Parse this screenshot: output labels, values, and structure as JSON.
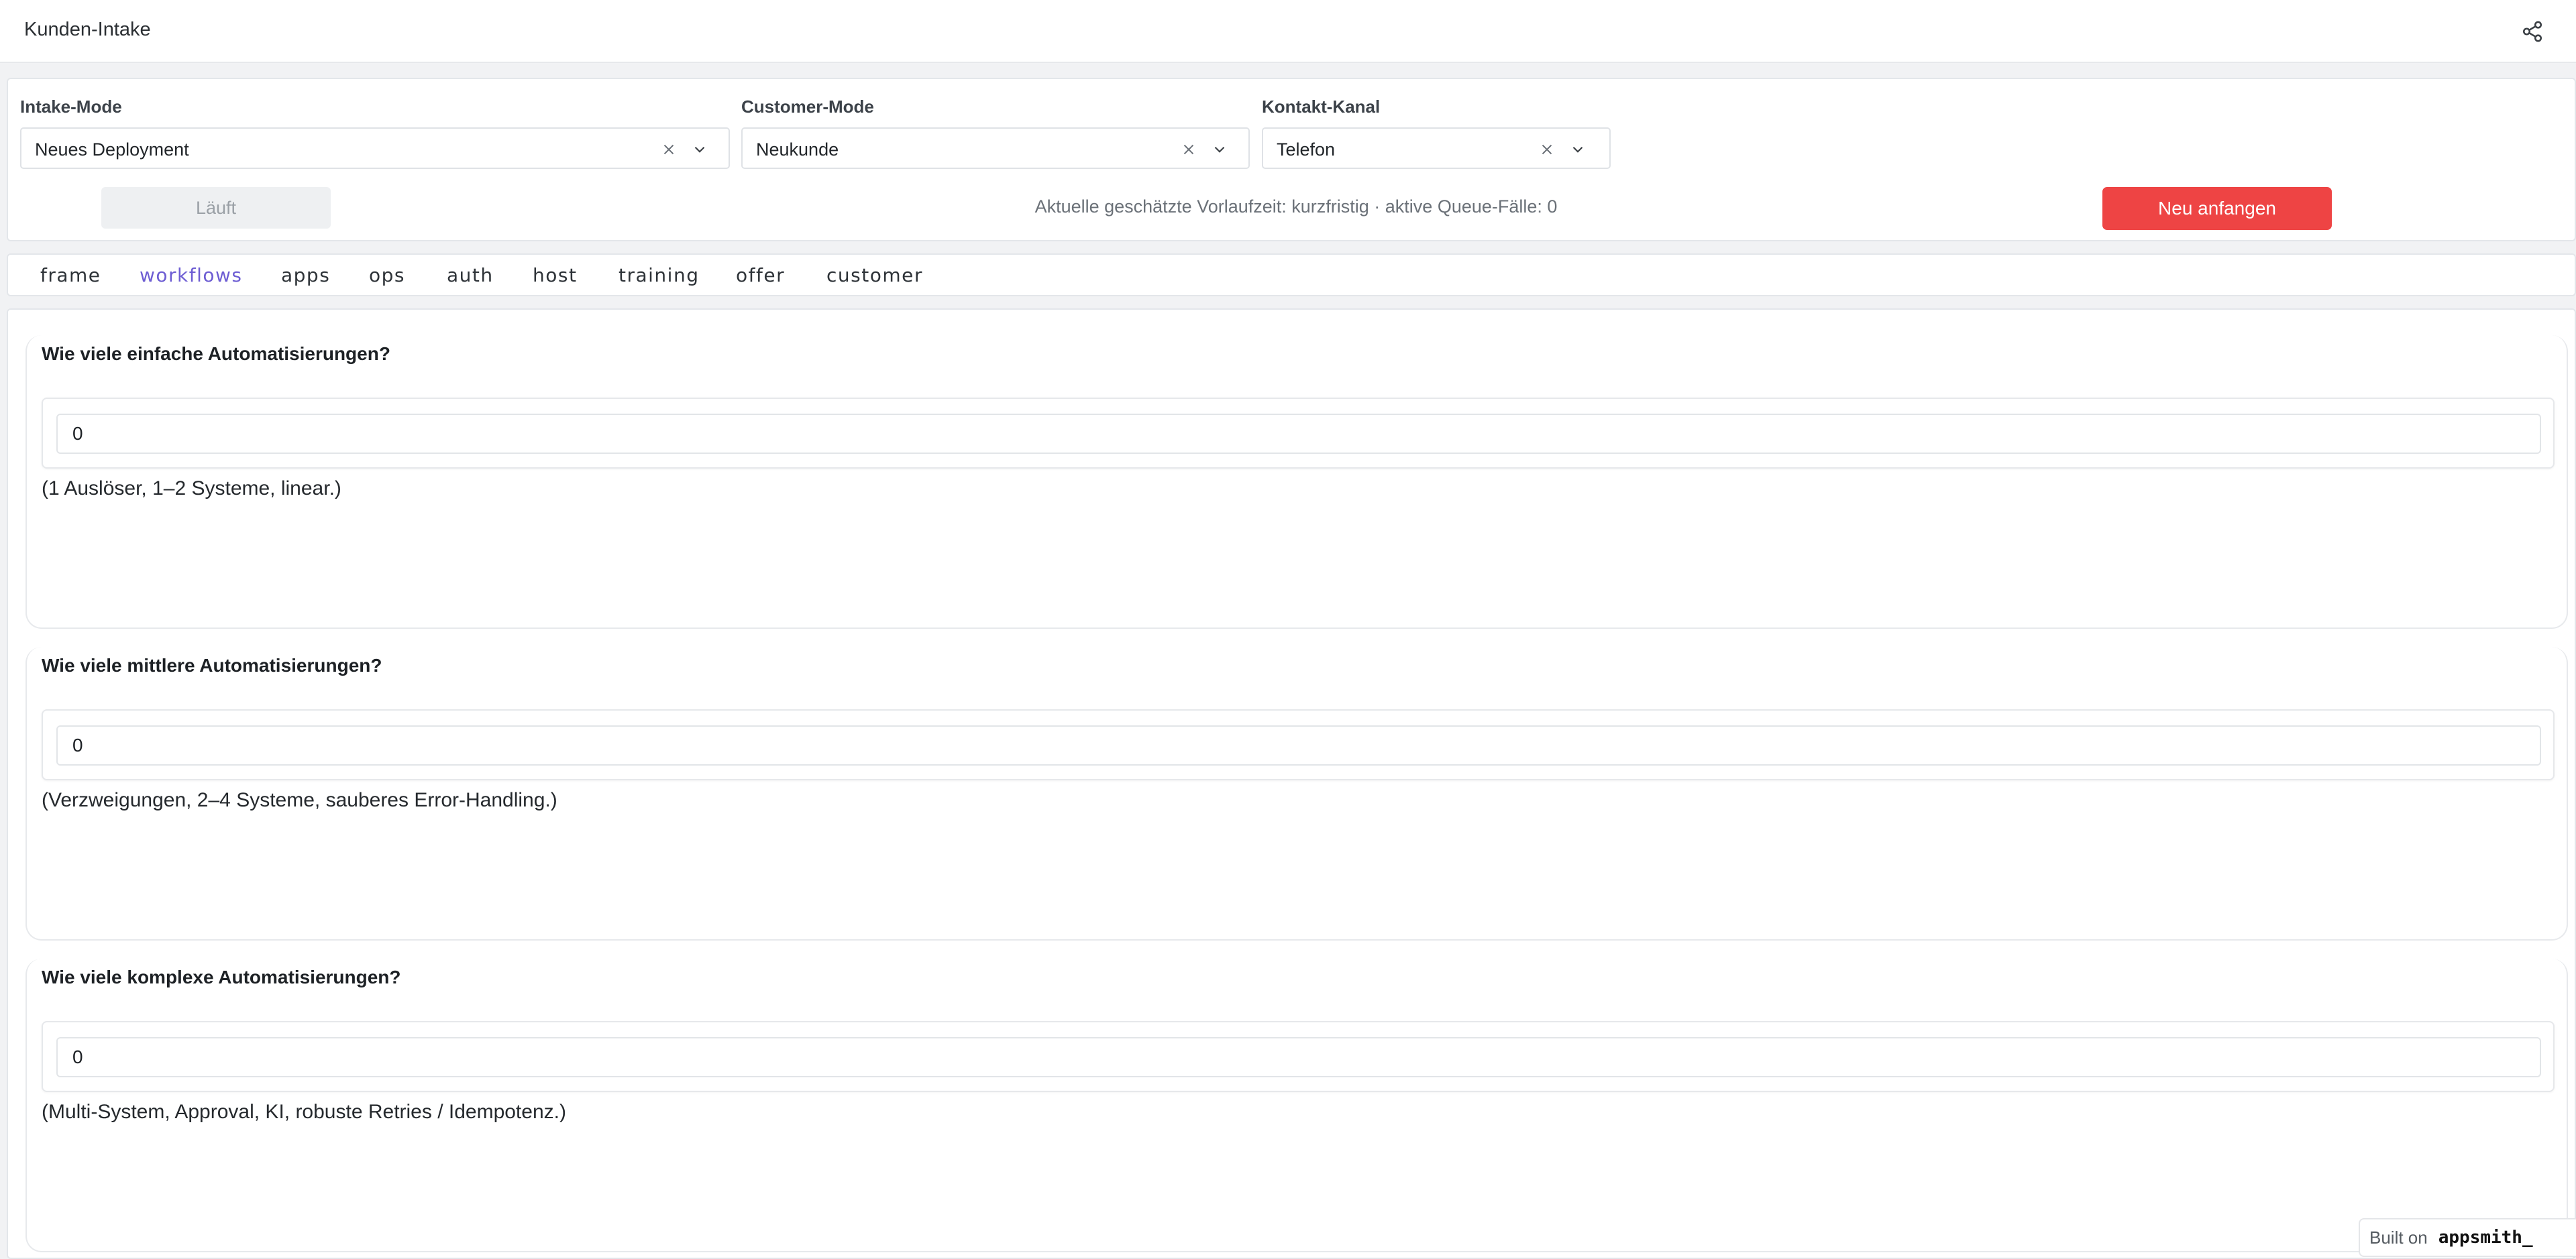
{
  "header": {
    "title": "Kunden-Intake",
    "share_icon": "share-icon"
  },
  "filters": {
    "intake_mode": {
      "label": "Intake-Mode",
      "value": "Neues Deployment"
    },
    "customer_mode": {
      "label": "Customer-Mode",
      "value": "Neukunde"
    },
    "contact_channel": {
      "label": "Kontakt-Kanal",
      "value": "Telefon"
    }
  },
  "actions": {
    "run_label": "Läuft",
    "status_text": "Aktuelle geschätzte Vorlaufzeit: kurzfristig · aktive Queue-Fälle: 0",
    "restart_label": "Neu anfangen",
    "restart_color": "#ee4444"
  },
  "tabs": [
    {
      "label": "frame"
    },
    {
      "label": "workflows",
      "active": true
    },
    {
      "label": "apps"
    },
    {
      "label": "ops"
    },
    {
      "label": "auth"
    },
    {
      "label": "host"
    },
    {
      "label": "training"
    },
    {
      "label": "offer"
    },
    {
      "label": "customer"
    }
  ],
  "accent_color": "#6d5dd3",
  "questions": [
    {
      "title": "Wie viele einfache Automatisierungen?",
      "value": "0",
      "hint": "(1 Auslöser, 1–2 Systeme, linear.)"
    },
    {
      "title": "Wie viele mittlere Automatisierungen?",
      "value": "0",
      "hint": "(Verzweigungen, 2–4 Systeme, sauberes Error-Handling.)"
    },
    {
      "title": "Wie viele komplexe Automatisierungen?",
      "value": "0",
      "hint": "(Multi-System, Approval, KI, robuste Retries / Idempotenz.)"
    }
  ],
  "footer": {
    "built_on": "Built on",
    "brand": "appsmith_"
  }
}
